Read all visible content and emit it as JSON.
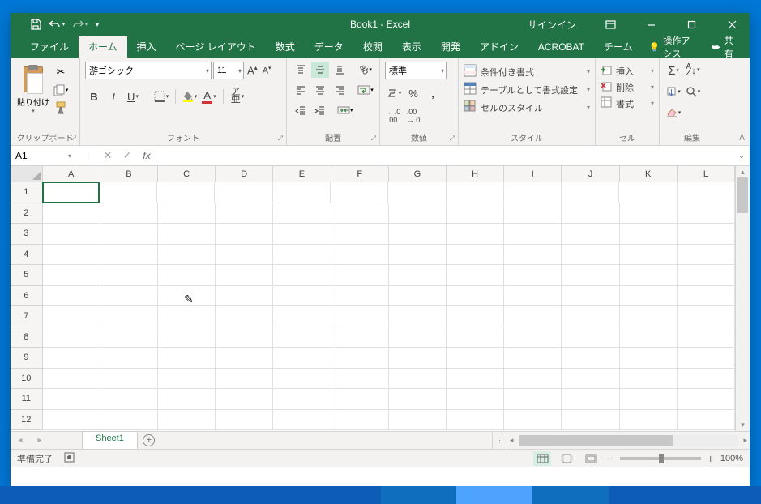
{
  "titlebar": {
    "title": "Book1 - Excel",
    "signin": "サインイン"
  },
  "tabs": {
    "file": "ファイル",
    "home": "ホーム",
    "insert": "挿入",
    "pagelayout": "ページ レイアウト",
    "formulas": "数式",
    "data": "データ",
    "review": "校閲",
    "view": "表示",
    "developer": "開発",
    "addins": "アドイン",
    "acrobat": "ACROBAT",
    "team": "チーム",
    "tell": "操作アシス",
    "share": "共有"
  },
  "ribbon": {
    "clipboard": {
      "paste": "貼り付け",
      "label": "クリップボード"
    },
    "font": {
      "name": "游ゴシック",
      "size": "11",
      "label": "フォント"
    },
    "alignment": {
      "label": "配置"
    },
    "number": {
      "format": "標準",
      "label": "数値"
    },
    "styles": {
      "cond": "条件付き書式",
      "table": "テーブルとして書式設定",
      "cell": "セルのスタイル",
      "label": "スタイル"
    },
    "cells": {
      "insert": "挿入",
      "delete": "削除",
      "format": "書式",
      "label": "セル"
    },
    "editing": {
      "label": "編集"
    }
  },
  "formula": {
    "namebox": "A1"
  },
  "grid": {
    "cols": [
      "A",
      "B",
      "C",
      "D",
      "E",
      "F",
      "G",
      "H",
      "I",
      "J",
      "K",
      "L"
    ],
    "rows": [
      "1",
      "2",
      "3",
      "4",
      "5",
      "6",
      "7",
      "8",
      "9",
      "10",
      "11",
      "12"
    ]
  },
  "sheet": {
    "name": "Sheet1"
  },
  "status": {
    "ready": "準備完了",
    "zoom": "100%"
  }
}
